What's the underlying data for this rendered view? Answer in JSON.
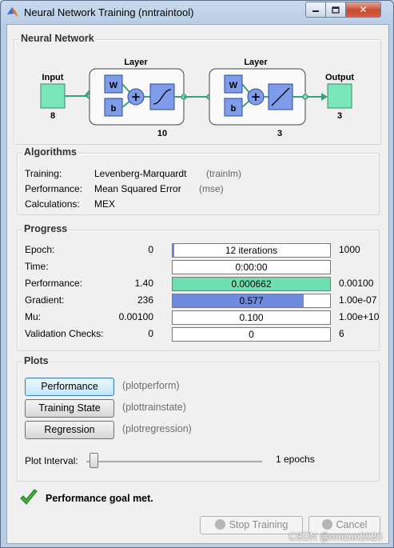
{
  "window": {
    "title": "Neural Network Training (nntraintool)"
  },
  "network": {
    "section_title": "Neural Network",
    "input": {
      "label": "Input",
      "size": "8"
    },
    "hidden_layer": {
      "label": "Layer",
      "size": "10",
      "w": "W",
      "b": "b"
    },
    "output_layer": {
      "label": "Layer",
      "size": "3",
      "w": "W",
      "b": "b"
    },
    "output": {
      "label": "Output",
      "size": "3"
    }
  },
  "algorithms": {
    "section_title": "Algorithms",
    "rows": [
      {
        "label": "Training:",
        "value": "Levenberg-Marquardt",
        "fn": "(trainlm)"
      },
      {
        "label": "Performance:",
        "value": "Mean Squared Error",
        "fn": "(mse)"
      },
      {
        "label": "Calculations:",
        "value": "MEX",
        "fn": ""
      }
    ]
  },
  "progress": {
    "section_title": "Progress",
    "rows": [
      {
        "label": "Epoch:",
        "start": "0",
        "bar_text": "12 iterations",
        "end": "1000",
        "fill": 0.012,
        "color": "#6f8be0"
      },
      {
        "label": "Time:",
        "start": "",
        "bar_text": "0:00:00",
        "end": "",
        "fill": 0,
        "color": "#6f8be0"
      },
      {
        "label": "Performance:",
        "start": "1.40",
        "bar_text": "0.000662",
        "end": "0.00100",
        "fill": 1.0,
        "color": "#6ee0b0"
      },
      {
        "label": "Gradient:",
        "start": "236",
        "bar_text": "0.577",
        "end": "1.00e-07",
        "fill": 0.83,
        "color": "#6f8be0"
      },
      {
        "label": "Mu:",
        "start": "0.00100",
        "bar_text": "0.100",
        "end": "1.00e+10",
        "fill": 0,
        "color": "#6f8be0"
      },
      {
        "label": "Validation Checks:",
        "start": "0",
        "bar_text": "0",
        "end": "6",
        "fill": 0,
        "color": "#6f8be0"
      }
    ]
  },
  "plots": {
    "section_title": "Plots",
    "buttons": [
      {
        "label": "Performance",
        "fn": "(plotperform)"
      },
      {
        "label": "Training State",
        "fn": "(plottrainstate)"
      },
      {
        "label": "Regression",
        "fn": "(plotregression)"
      }
    ],
    "interval_label": "Plot Interval:",
    "interval_value": "1 epochs",
    "interval_slider": 0
  },
  "status": {
    "message": "Performance goal met."
  },
  "footer": {
    "stop_label": "Stop Training",
    "cancel_label": "Cancel"
  },
  "watermark": "CSDN @mozun2020",
  "colors": {
    "accent_green": "#6ee0b0",
    "accent_blue": "#6f8be0",
    "node_blue": "#7e9ce8"
  }
}
